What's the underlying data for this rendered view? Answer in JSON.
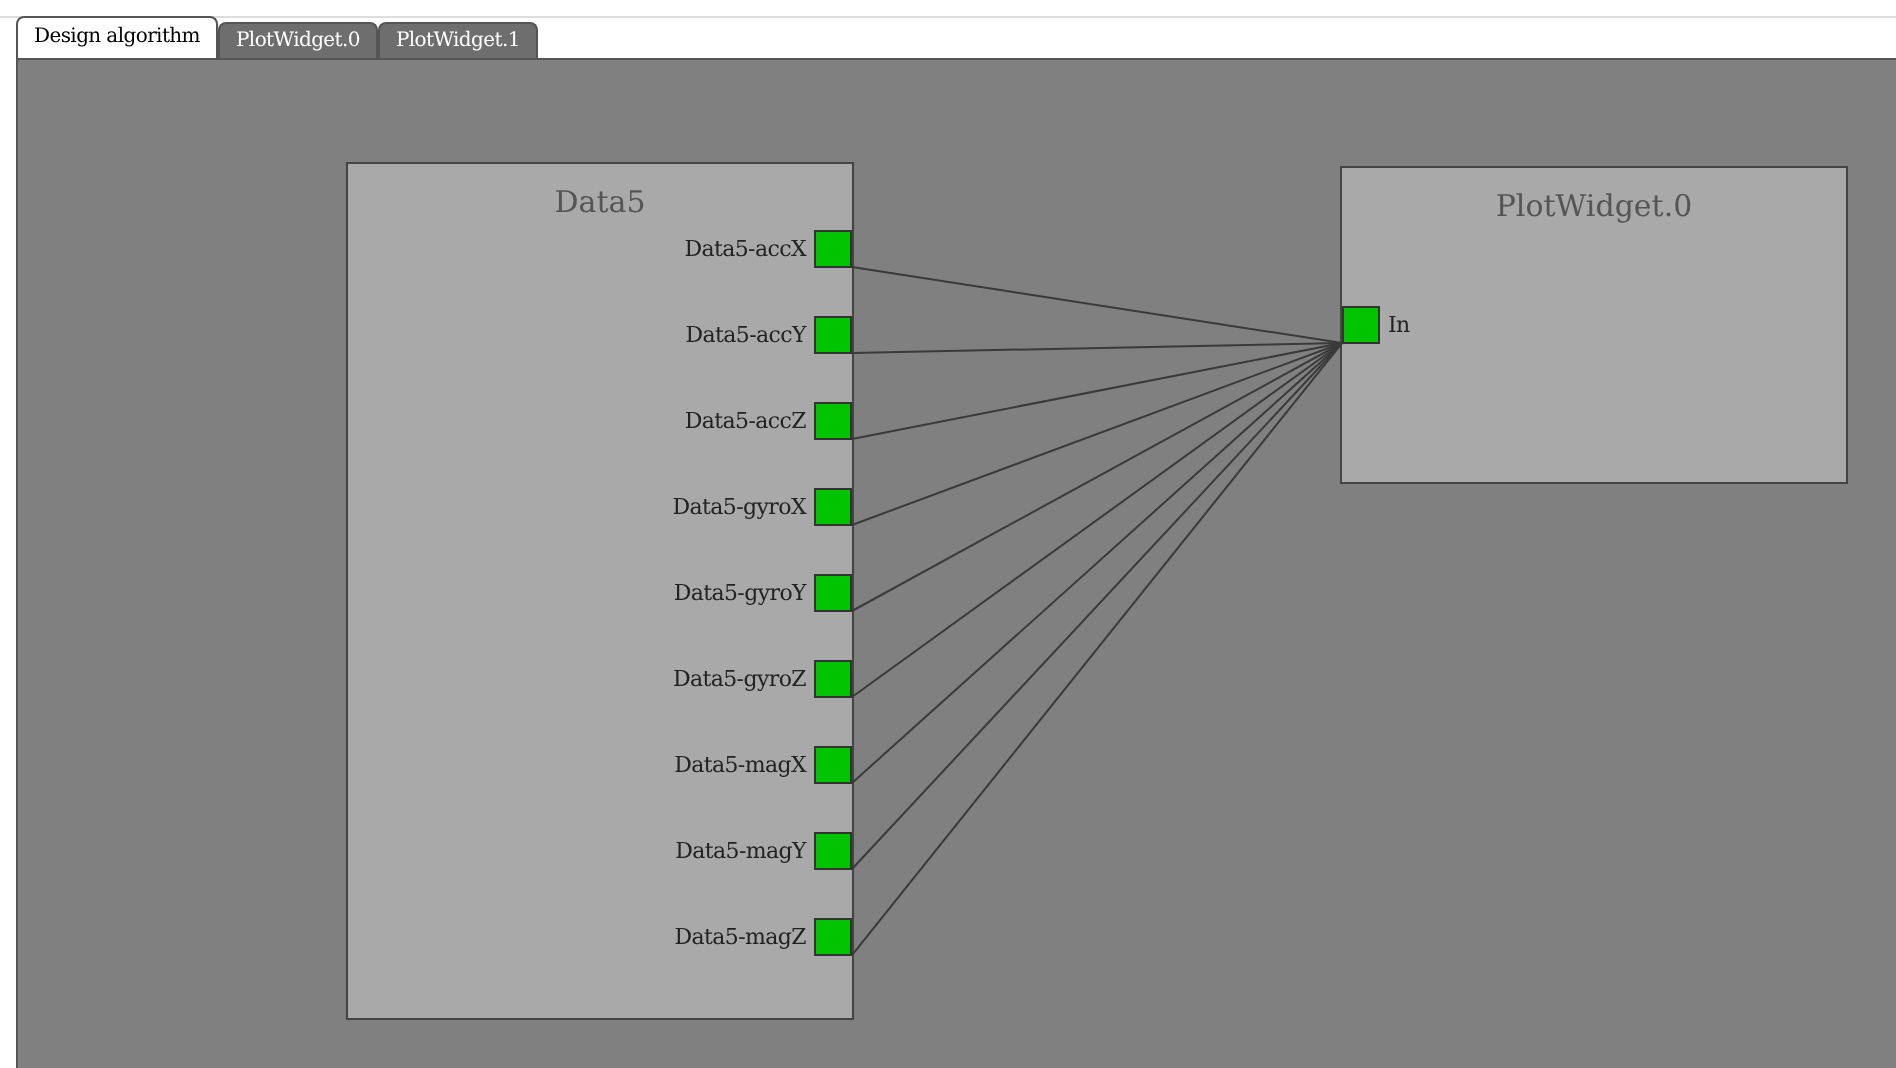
{
  "tabs": [
    {
      "label": "Design algorithm",
      "selected": true
    },
    {
      "label": "PlotWidget.0",
      "selected": false
    },
    {
      "label": "PlotWidget.1",
      "selected": false
    }
  ],
  "nodes": [
    {
      "kind": "source",
      "title": "Data5",
      "ports": [
        {
          "label": "Data5-accX",
          "connected": true
        },
        {
          "label": "Data5-accY",
          "connected": true
        },
        {
          "label": "Data5-accZ",
          "connected": true
        },
        {
          "label": "Data5-gyroX",
          "connected": true
        },
        {
          "label": "Data5-gyroY",
          "connected": true
        },
        {
          "label": "Data5-gyroZ",
          "connected": true
        },
        {
          "label": "Data5-magX",
          "connected": true
        },
        {
          "label": "Data5-magY",
          "connected": true
        },
        {
          "label": "Data5-magZ",
          "connected": true
        }
      ]
    },
    {
      "kind": "sink",
      "title": "PlotWidget.0",
      "ports": [
        {
          "label": "In",
          "connected": true
        }
      ]
    }
  ]
}
